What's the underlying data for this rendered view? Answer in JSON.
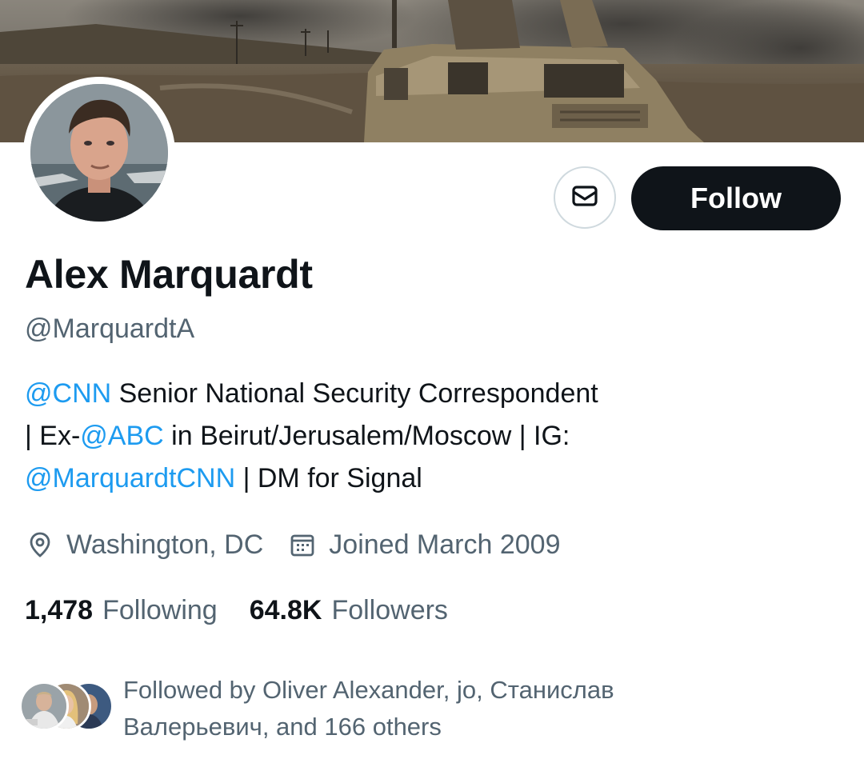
{
  "profile": {
    "name": "Alex Marquardt",
    "handle": "@MarquardtA",
    "follow_label": "Follow",
    "message_icon": "envelope-icon",
    "banner": "desert-military-vehicle-photo",
    "avatar": "profile-photo"
  },
  "bio": {
    "line1": {
      "mention": "@CNN",
      "text": " Senior National Security Correspondent"
    },
    "line2": {
      "prefix": "| Ex-",
      "mention": "@ABC",
      "text": " in Beirut/Jerusalem/Moscow | IG:"
    },
    "line3": {
      "mention": "@MarquardtCNN",
      "text": " | DM for Signal"
    }
  },
  "meta": {
    "location": "Washington, DC",
    "location_icon": "location-pin-icon",
    "joined": "Joined March 2009",
    "joined_icon": "calendar-icon"
  },
  "stats": {
    "following_count": "1,478",
    "following_label": "Following",
    "followers_count": "64.8K",
    "followers_label": "Followers"
  },
  "followed_by": {
    "line1": "Followed by Oliver Alexander, jo, Станислав",
    "line2": "Валерьевич, and 166 others"
  },
  "colors": {
    "accent": "#1d9bf0",
    "text_primary": "#0f1419",
    "text_secondary": "#536471",
    "button_dark": "#0f1419",
    "border": "#cfd9de"
  }
}
